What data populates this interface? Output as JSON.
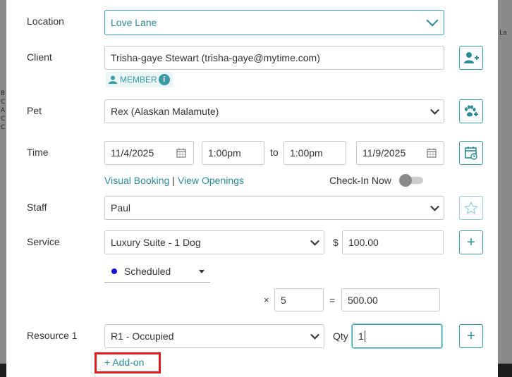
{
  "location": {
    "label": "Location",
    "value": "Love Lane"
  },
  "client": {
    "label": "Client",
    "value": "Trisha-gaye Stewart (trisha-gaye@mytime.com)",
    "badge": "MEMBER",
    "add_icon": "add-user-icon"
  },
  "pet": {
    "label": "Pet",
    "value": "Rex (Alaskan Malamute)",
    "add_icon": "paw-plus-icon"
  },
  "time": {
    "label": "Time",
    "start_date": "11/4/2025",
    "start_time": "1:00pm",
    "to_label": "to",
    "end_time": "1:00pm",
    "end_date": "11/9/2025",
    "visual_booking": "Visual Booking",
    "separator": "|",
    "view_openings": "View Openings",
    "check_in_label": "Check-In Now",
    "check_in_on": false
  },
  "staff": {
    "label": "Staff",
    "value": "Paul",
    "star_icon": "star-icon"
  },
  "service": {
    "label": "Service",
    "value": "Luxury Suite - 1 Dog",
    "currency": "$",
    "price": "100.00",
    "status": "Scheduled",
    "status_color": "#1414d4",
    "multiply": "×",
    "quantity": "5",
    "equals": "=",
    "total": "500.00"
  },
  "resource": {
    "label": "Resource 1",
    "value": "R1 - Occupied",
    "qty_label": "Qty",
    "qty_value": "1"
  },
  "add_on_link": "+ Add-on",
  "backdrop_text": {
    "left": [
      "B",
      "C",
      "A",
      "C",
      "C"
    ],
    "right_top": "La"
  },
  "colors": {
    "accent": "#3a9aa6",
    "highlight": "#e01b1b"
  }
}
